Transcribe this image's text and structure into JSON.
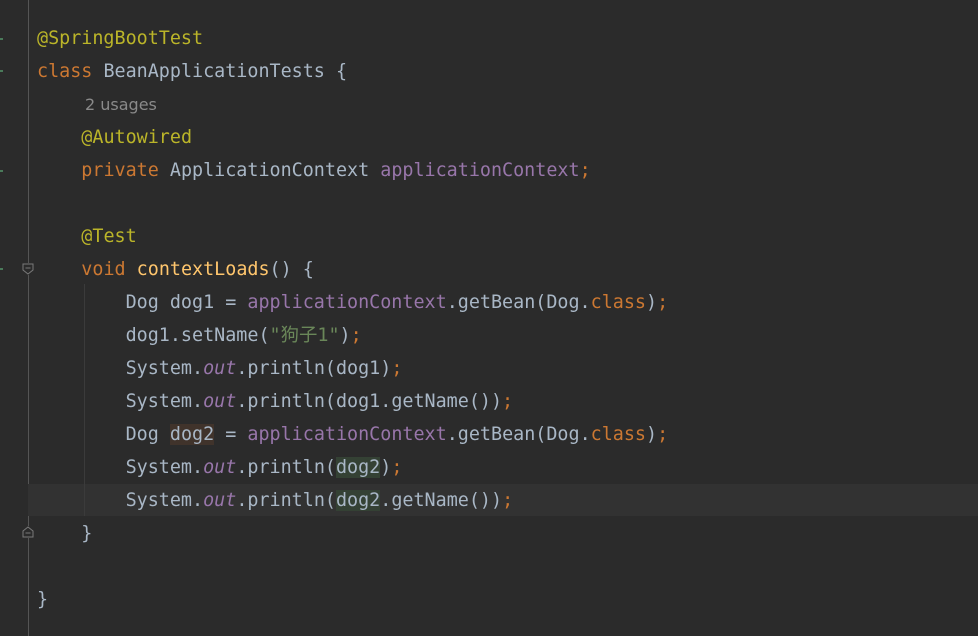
{
  "editor": {
    "lines": [
      {
        "id": "l1",
        "tokens": [
          [
            "ann",
            "@SpringBootTest"
          ]
        ]
      },
      {
        "id": "l2",
        "tokens": [
          [
            "kw",
            "class "
          ],
          [
            "",
            "BeanApplicationTests {"
          ]
        ]
      },
      {
        "id": "l3",
        "hint": "2 usages"
      },
      {
        "id": "l4",
        "tokens": [
          [
            "",
            "    "
          ],
          [
            "ann",
            "@Autowired"
          ]
        ]
      },
      {
        "id": "l5",
        "tokens": [
          [
            "",
            "    "
          ],
          [
            "kw",
            "private "
          ],
          [
            "",
            "ApplicationContext "
          ],
          [
            "fld",
            "applicationContext"
          ],
          [
            "semi",
            ";"
          ]
        ]
      },
      {
        "id": "l6",
        "tokens": []
      },
      {
        "id": "l7",
        "tokens": [
          [
            "",
            "    "
          ],
          [
            "ann",
            "@Test"
          ]
        ]
      },
      {
        "id": "l8",
        "tokens": [
          [
            "",
            "    "
          ],
          [
            "kw",
            "void "
          ],
          [
            "fn",
            "contextLoads"
          ],
          [
            "",
            "() {"
          ]
        ]
      },
      {
        "id": "l9",
        "tokens": [
          [
            "",
            "        Dog dog1 = "
          ],
          [
            "fld",
            "applicationContext"
          ],
          [
            "",
            ".getBean(Dog."
          ],
          [
            "kw",
            "class"
          ],
          [
            "",
            ")"
          ],
          [
            "semi",
            ";"
          ]
        ]
      },
      {
        "id": "l10",
        "tokens": [
          [
            "",
            "        dog1.setName("
          ],
          [
            "str",
            "\"狗子1\""
          ],
          [
            "",
            ")"
          ],
          [
            "semi",
            ";"
          ]
        ]
      },
      {
        "id": "l11",
        "tokens": [
          [
            "",
            "        System."
          ],
          [
            "sfld",
            "out"
          ],
          [
            "",
            ".println(dog1)"
          ],
          [
            "semi",
            ";"
          ]
        ]
      },
      {
        "id": "l12",
        "tokens": [
          [
            "",
            "        System."
          ],
          [
            "sfld",
            "out"
          ],
          [
            "",
            ".println(dog1.getName())"
          ],
          [
            "semi",
            ";"
          ]
        ]
      },
      {
        "id": "l13",
        "tokens": [
          [
            "",
            "        Dog "
          ],
          [
            "hl-write",
            "dog2"
          ],
          [
            "",
            " = "
          ],
          [
            "fld",
            "applicationContext"
          ],
          [
            "",
            ".getBean(Dog."
          ],
          [
            "kw",
            "class"
          ],
          [
            "",
            ")"
          ],
          [
            "semi",
            ";"
          ]
        ]
      },
      {
        "id": "l14",
        "tokens": [
          [
            "",
            "        System."
          ],
          [
            "sfld",
            "out"
          ],
          [
            "",
            ".println("
          ],
          [
            "hl-read",
            "dog2"
          ],
          [
            "",
            ")"
          ],
          [
            "semi",
            ";"
          ]
        ]
      },
      {
        "id": "l15",
        "tokens": [
          [
            "",
            "        System."
          ],
          [
            "sfld",
            "out"
          ],
          [
            "",
            ".println("
          ],
          [
            "hl-read",
            "dog2"
          ],
          [
            "",
            ".getName())"
          ],
          [
            "semi",
            ";"
          ]
        ]
      },
      {
        "id": "l16",
        "tokens": [
          [
            "",
            "    }"
          ]
        ]
      },
      {
        "id": "l17",
        "tokens": []
      },
      {
        "id": "l18",
        "tokens": [
          [
            "",
            "}"
          ]
        ]
      }
    ]
  },
  "colors": {
    "background": "#2b2b2b",
    "keyword": "#cc7832",
    "annotation": "#bbb529",
    "field": "#9876aa",
    "method_decl": "#ffc66d",
    "string": "#6a8759",
    "text": "#a9b7c6",
    "inlay_hint": "#8a8a8a",
    "current_line": "#323232"
  },
  "icons": {
    "fold_open": "fold-start-icon",
    "fold_close": "fold-end-icon"
  }
}
